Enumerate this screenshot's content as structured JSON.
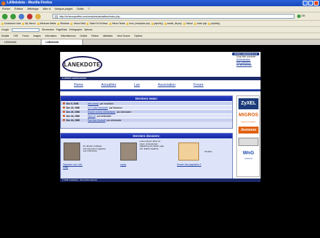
{
  "window": {
    "title": "LANekdote - Mozilla Firefox"
  },
  "menu": [
    "Fichier",
    "Édition",
    "Affichage",
    "Aller à",
    "Marque-pages",
    "Outils",
    "?"
  ],
  "url": "http://lnl.lenoopoffed.com/modules/actualites/index.php",
  "go_label": "OK",
  "bookmarks": [
    "Customize Links",
    "My Yahoo!",
    "Windows Media",
    "Windows",
    "Yahoo! Mail",
    "Taste FoOd News",
    "Yahoo! News",
    "form_inscription.php",
    "phpinfo()",
    "create_db.php",
    "Yahoo!",
    "index.php",
    "phpinfo()"
  ],
  "toolbar1": {
    "google": "Google",
    "search": "Rechercher",
    "pagerank": "PageRank",
    "spell": "Orthographe",
    "options": "Options"
  },
  "toolbar2": [
    "Disable",
    "CSS",
    "Forms",
    "Images",
    "Information",
    "Miscellaneous",
    "Outline",
    "Resize",
    "Validation",
    "View Source",
    "Options"
  ],
  "tabs": [
    "LANekdote",
    "LANekdote"
  ],
  "site": {
    "domain": "WWW.LANEKDOTE.CH",
    "logo": "LANEKDOTE",
    "assoc": "E-SPORT ASSOCIATION",
    "login": {
      "title": "Vous êtes connecté :",
      "l1": "Administration",
      "l2": "Mon password",
      "l3": "Se déconnecter"
    },
    "nav": [
      "Home",
      "Actualités",
      "Lan",
      "Association",
      "Forum"
    ],
    "news": {
      "title": "Derniers news:",
      "rows": [
        {
          "date": "Dec 5, 2006",
          "link": "test ovmap",
          "by": "par moolekrut"
        },
        {
          "date": "Dec 22, 2006",
          "link": "LCT LAN 8 terminée",
          "by": "par Madorom"
        },
        {
          "date": "Dec 20, 2006",
          "link": "Encore un test, Administrato",
          "by": "par webmaster"
        },
        {
          "date": "Dec 18, 2006",
          "link": "Test 1.5",
          "by": "par webmaster"
        },
        {
          "date": "Dec 16, 2006",
          "link": "Test Nice Newsaff",
          "by": "par webmaster"
        }
      ]
    },
    "dossiers": {
      "title": "Derniers dossiers:",
      "items": [
        {
          "text": "Ce dossier explique comment bien organiser une LAN-Party",
          "link": "Organiser une LAN-Party"
        },
        {
          "text": "Lorem ipsum dolor sit amet, consectetuer adipiscing elit. Etiam eget dui. Nullam dapibus.",
          "link": "zqzzg"
        },
        {
          "text": "Testette",
          "link": "Dossier test pagination 2"
        }
      ]
    },
    "footer": "© 2006 Lanekdote - Tous droits réservés",
    "sponsors": [
      "ZyXEL",
      "MIGROS",
      "loisirs et culture",
      "Jeunesse",
      "WnG",
      "solutions"
    ]
  }
}
